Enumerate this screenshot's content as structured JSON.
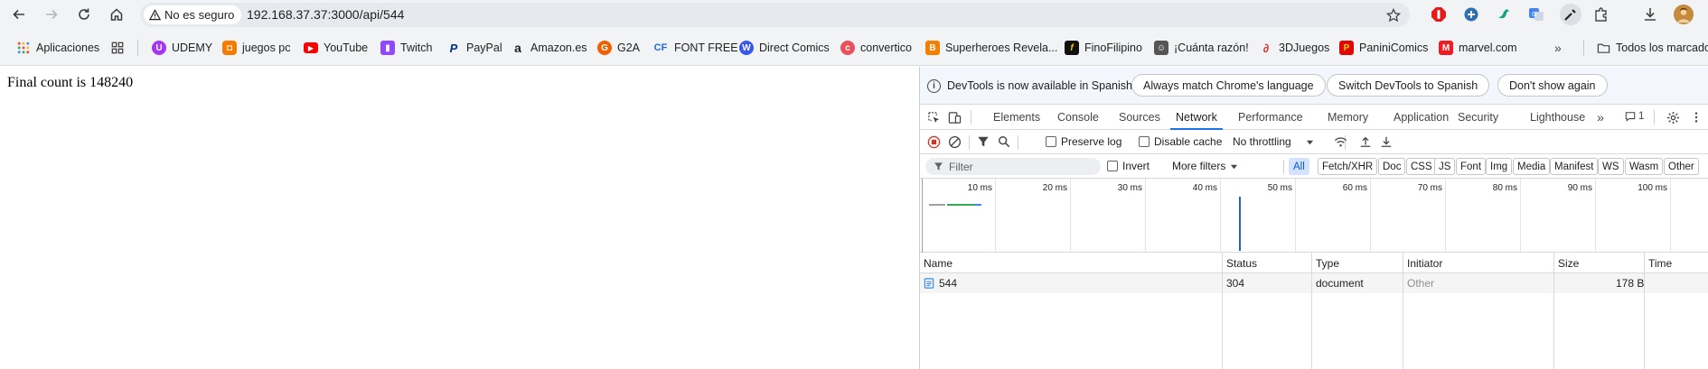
{
  "omnibox": {
    "security_label": "No es seguro",
    "url": "192.168.37.37:3000/api/544"
  },
  "bookmarks": [
    {
      "label": "Aplicaciones",
      "icon": "apps-grid-icon"
    },
    {
      "label": "UDEMY",
      "icon": "udemy-icon",
      "color": "#a435f0"
    },
    {
      "label": "juegos pc",
      "icon": "gamepad-icon",
      "color": "#f57c00"
    },
    {
      "label": "YouTube",
      "icon": "youtube-icon",
      "color": "#ff0000"
    },
    {
      "label": "Twitch",
      "icon": "twitch-icon",
      "color": "#9146ff"
    },
    {
      "label": "PayPal",
      "icon": "paypal-icon",
      "color": "#003087"
    },
    {
      "label": "Amazon.es",
      "icon": "amazon-icon",
      "color": "#222222"
    },
    {
      "label": "G2A",
      "icon": "g2a-icon",
      "color": "#f05f00"
    },
    {
      "label": "FONT FREE",
      "icon": "fontfree-icon",
      "color": "#1e6bd6"
    },
    {
      "label": "Direct Comics",
      "icon": "wordpress-icon",
      "color": "#3858e9"
    },
    {
      "label": "convertico",
      "icon": "convertico-icon",
      "color": "#e8505b"
    },
    {
      "label": "Superheroes Revela...",
      "icon": "blogger-icon",
      "color": "#f57d00"
    },
    {
      "label": "FinoFilipino",
      "icon": "finofilipino-icon",
      "color": "#111111"
    },
    {
      "label": "¡Cuánta razón!",
      "icon": "cuantarazon-icon",
      "color": "#555555"
    },
    {
      "label": "3DJuegos",
      "icon": "3djuegos-icon",
      "color": "#d32f2f"
    },
    {
      "label": "PaniniComics",
      "icon": "panini-icon",
      "color": "#e10600"
    },
    {
      "label": "marvel.com",
      "icon": "marvel-icon",
      "color": "#ec1d24"
    },
    {
      "label": "Todos los marcadores",
      "icon": "folder-icon"
    }
  ],
  "page": {
    "text": "Final count is 148240"
  },
  "devtools": {
    "infobar": {
      "message": "DevTools is now available in Spanish!",
      "btn_match": "Always match Chrome's language",
      "btn_switch": "Switch DevTools to Spanish",
      "btn_dismiss": "Don't show again"
    },
    "tabs": [
      "Elements",
      "Console",
      "Sources",
      "Network",
      "Performance",
      "Memory",
      "Application",
      "Security",
      "Lighthouse"
    ],
    "active_tab": "Network",
    "message_count": "1",
    "toolbar": {
      "preserve_log": "Preserve log",
      "disable_cache": "Disable cache",
      "throttling": "No throttling"
    },
    "filter": {
      "placeholder": "Filter",
      "invert": "Invert",
      "more_filters": "More filters",
      "types": [
        "All",
        "Fetch/XHR",
        "Doc",
        "CSS",
        "JS",
        "Font",
        "Img",
        "Media",
        "Manifest",
        "WS",
        "Wasm",
        "Other"
      ],
      "active_type": "All"
    },
    "overview_ticks": [
      "10 ms",
      "20 ms",
      "30 ms",
      "40 ms",
      "50 ms",
      "60 ms",
      "70 ms",
      "80 ms",
      "90 ms",
      "100 ms"
    ],
    "table": {
      "columns": [
        "Name",
        "Status",
        "Type",
        "Initiator",
        "Size",
        "Time"
      ],
      "rows": [
        {
          "name": "544",
          "status": "304",
          "type": "document",
          "initiator": "Other",
          "size": "178 B",
          "time": ""
        }
      ]
    }
  },
  "colors": {
    "accent": "#1a73e8",
    "chrome_bg": "#f1f3f4",
    "record_red": "#d93025"
  }
}
